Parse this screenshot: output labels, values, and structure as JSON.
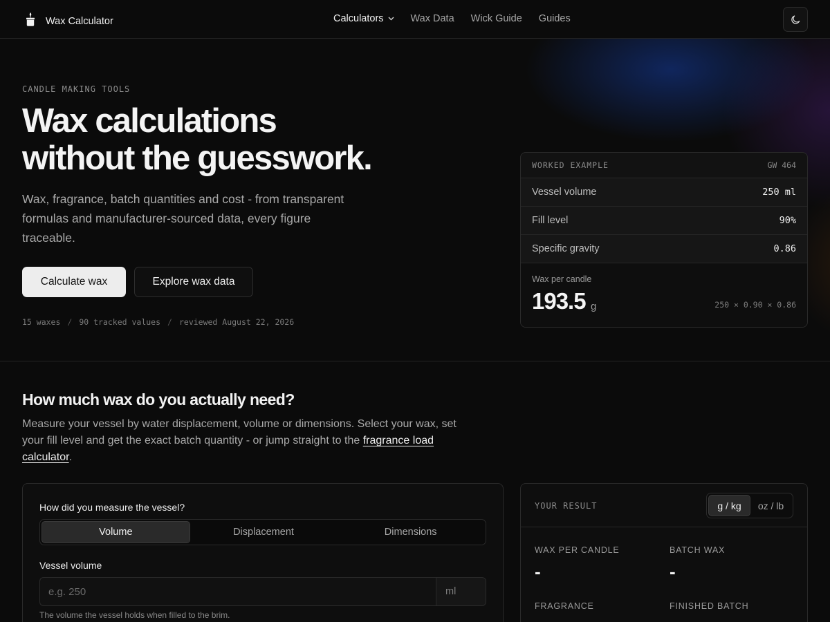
{
  "header": {
    "brand_name": "Wax Calculator",
    "nav": [
      {
        "label": "Calculators",
        "has_dropdown": true,
        "active": true
      },
      {
        "label": "Wax Data"
      },
      {
        "label": "Wick Guide"
      },
      {
        "label": "Guides"
      }
    ],
    "theme_icon": "moon-icon"
  },
  "hero": {
    "eyebrow": "CANDLE MAKING TOOLS",
    "title_line1": "Wax calculations",
    "title_line2": "without the guesswork.",
    "subtitle": "Wax, fragrance, batch quantities and cost - from transparent formulas and manufacturer-sourced data, every figure traceable.",
    "primary_button": "Calculate wax",
    "secondary_button": "Explore wax data",
    "stats": [
      "15 waxes",
      "90 tracked values",
      "reviewed August 22, 2026"
    ],
    "stats_separator": "/"
  },
  "example": {
    "label": "WORKED EXAMPLE",
    "code": "GW 464",
    "rows": [
      {
        "key": "Vessel volume",
        "value": "250 ml"
      },
      {
        "key": "Fill level",
        "value": "90%"
      },
      {
        "key": "Specific gravity",
        "value": "0.86"
      }
    ],
    "result_label": "Wax per candle",
    "result_value": "193.5",
    "result_unit": "g",
    "formula": "250 × 0.90 × 0.86"
  },
  "section": {
    "title": "How much wax do you actually need?",
    "desc_before": "Measure your vessel by water displacement, volume or dimensions. Select your wax, set your fill level and get the exact batch quantity - or jump straight to the ",
    "desc_link": "fragrance load calculator",
    "desc_after": "."
  },
  "form": {
    "question": "How did you measure the vessel?",
    "methods": [
      "Volume",
      "Displacement",
      "Dimensions"
    ],
    "selected_method": "Volume",
    "volume_label": "Vessel volume",
    "volume_placeholder": "e.g. 250",
    "volume_value": "",
    "volume_unit": "ml",
    "volume_help": "The volume the vessel holds when filled to the brim."
  },
  "result": {
    "title": "YOUR RESULT",
    "units": [
      "g / kg",
      "oz / lb"
    ],
    "selected_unit": "g / kg",
    "items": [
      {
        "label": "WAX PER CANDLE",
        "value": "-"
      },
      {
        "label": "BATCH WAX",
        "value": "-"
      },
      {
        "label": "FRAGRANCE",
        "value": ""
      },
      {
        "label": "FINISHED BATCH",
        "value": ""
      }
    ]
  },
  "colors": {
    "background": "#0b0b0b",
    "primary_button_bg": "#ededed",
    "accent_glow_blue": "#143ca0",
    "accent_glow_purple": "#461e6e"
  }
}
